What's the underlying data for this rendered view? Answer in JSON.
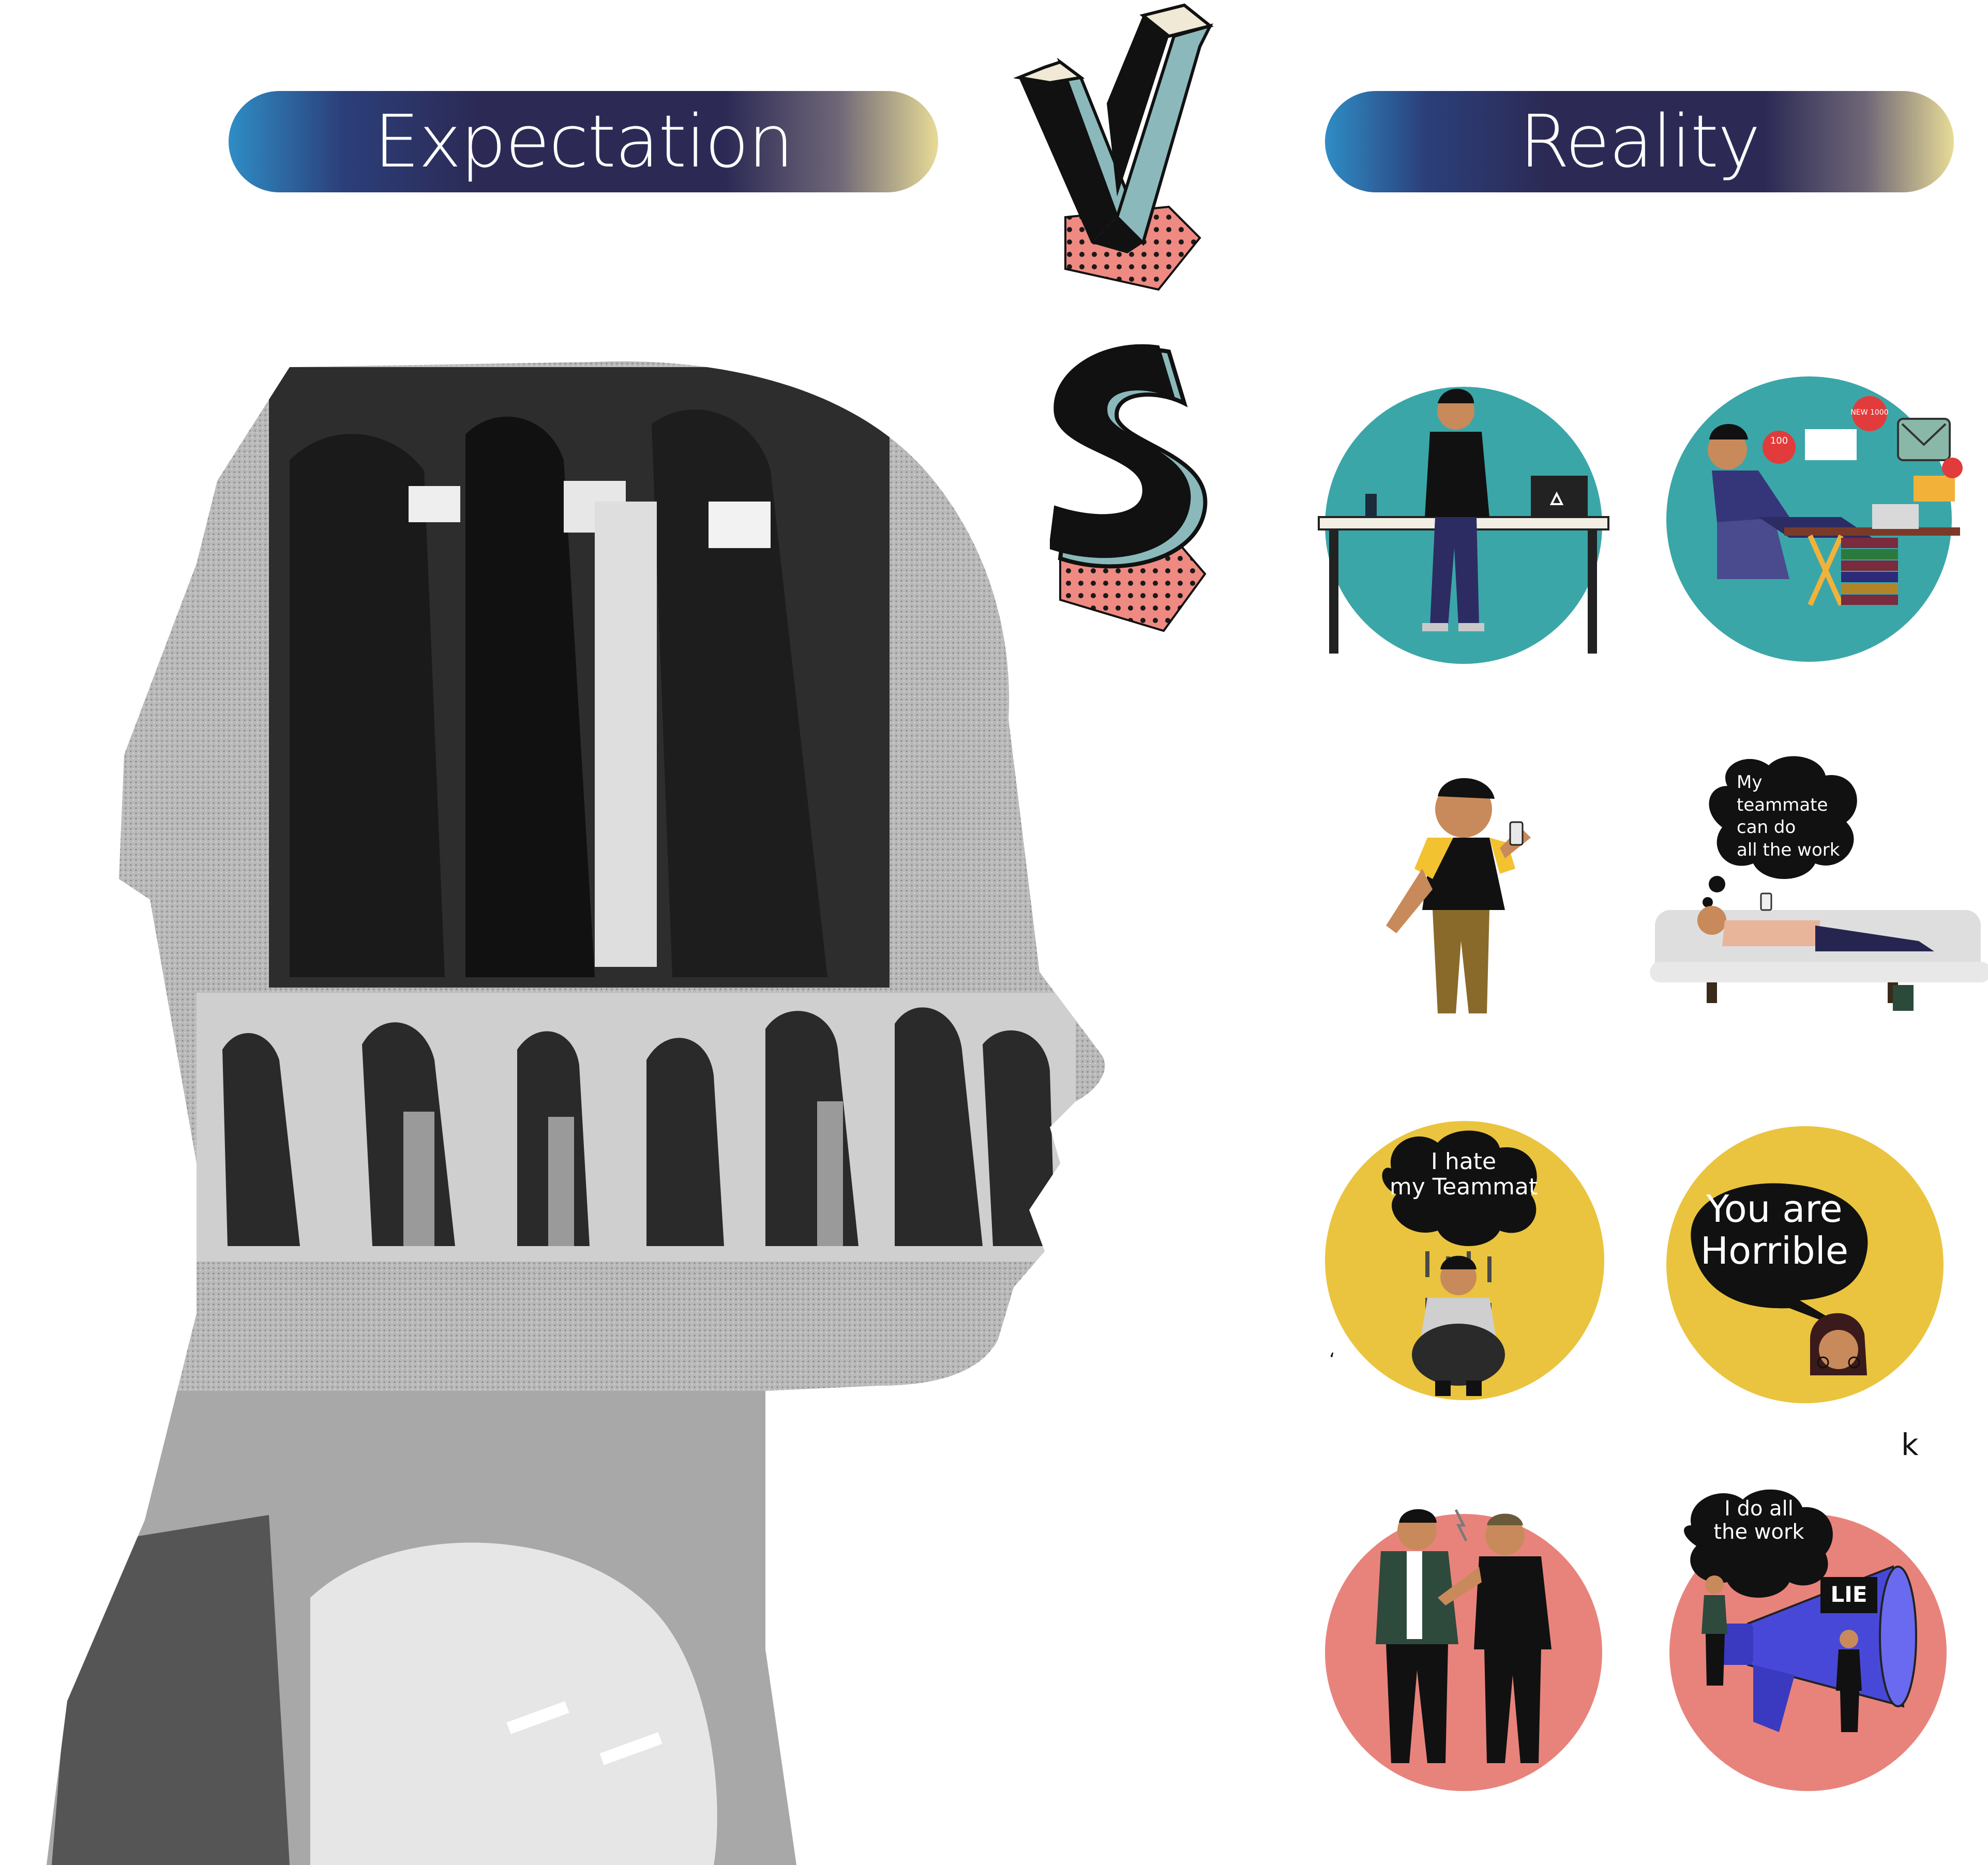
{
  "headers": {
    "expectation": "Expectation",
    "reality": "Reality"
  },
  "vs_letters": [
    "V",
    "S"
  ],
  "reality_panels": [
    {
      "id": "desk-frustrated",
      "background": "#3ba6a8",
      "speech": ""
    },
    {
      "id": "relaxed-notifications",
      "background": "#3ba6a8",
      "speech": "",
      "badges": [
        "100",
        "NEW 1000"
      ]
    },
    {
      "id": "angry-on-phone",
      "background": "#ffffff",
      "speech": ""
    },
    {
      "id": "lying-on-couch",
      "background": "#ffffff",
      "speech": "My teammate can do all the work",
      "speech_lines": [
        "My",
        "teammate",
        "can do",
        "all the work"
      ]
    },
    {
      "id": "sad-under-cloud",
      "background": "#eac43e",
      "speech": "I hate my Teammat",
      "speech_lines": [
        "I hate",
        "my Teammat"
      ]
    },
    {
      "id": "woman-insult",
      "background": "#eac43e",
      "speech": "You are Horrible",
      "speech_lines": [
        "You are",
        "Horrible"
      ]
    },
    {
      "id": "arguing-pair",
      "background": "#e8837c",
      "speech": ""
    },
    {
      "id": "megaphone-lie",
      "background": "#e8837c",
      "speech": "I do all the work",
      "speech_lines": [
        "I do all",
        "the work"
      ],
      "sign": "LIE"
    }
  ],
  "stray_marks": [
    "k",
    "‘"
  ],
  "colors": {
    "pill_gradient": [
      "#2f8dc6",
      "#2c2a55",
      "#e7db97"
    ],
    "teal": "#3ba6a8",
    "yellow": "#eac43e",
    "pink": "#e8837c",
    "vs_teal": "#8bb9bb",
    "vs_dots": "#ee8a82"
  }
}
